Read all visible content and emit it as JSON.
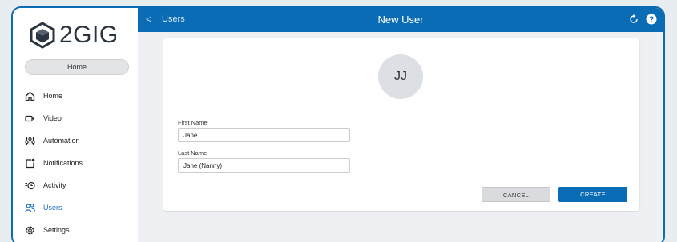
{
  "colors": {
    "brand": "#0a6cb5",
    "active_nav": "#1b6fc0",
    "avatar_bg": "#dcdfe3"
  },
  "logo": {
    "text": "2GIG",
    "icon": "2gig-logo-icon"
  },
  "sidebar": {
    "home_pill": "Home",
    "items": [
      {
        "label": "Home",
        "icon": "house-icon",
        "active": false
      },
      {
        "label": "Video",
        "icon": "video-camera-icon",
        "active": false
      },
      {
        "label": "Automation",
        "icon": "sliders-icon",
        "active": false
      },
      {
        "label": "Notifications",
        "icon": "bell-square-icon",
        "active": false
      },
      {
        "label": "Activity",
        "icon": "activity-icon",
        "active": false
      },
      {
        "label": "Users",
        "icon": "users-icon",
        "active": true
      },
      {
        "label": "Settings",
        "icon": "gear-icon",
        "active": false
      }
    ]
  },
  "topbar": {
    "back_glyph": "<",
    "breadcrumb": "Users",
    "title": "New User"
  },
  "form": {
    "avatar_initials": "JJ",
    "first_name_label": "First Name",
    "first_name_value": "Jane",
    "last_name_label": "Last Name",
    "last_name_value": "Jane (Nanny)",
    "cancel_label": "CANCEL",
    "create_label": "CREATE"
  }
}
